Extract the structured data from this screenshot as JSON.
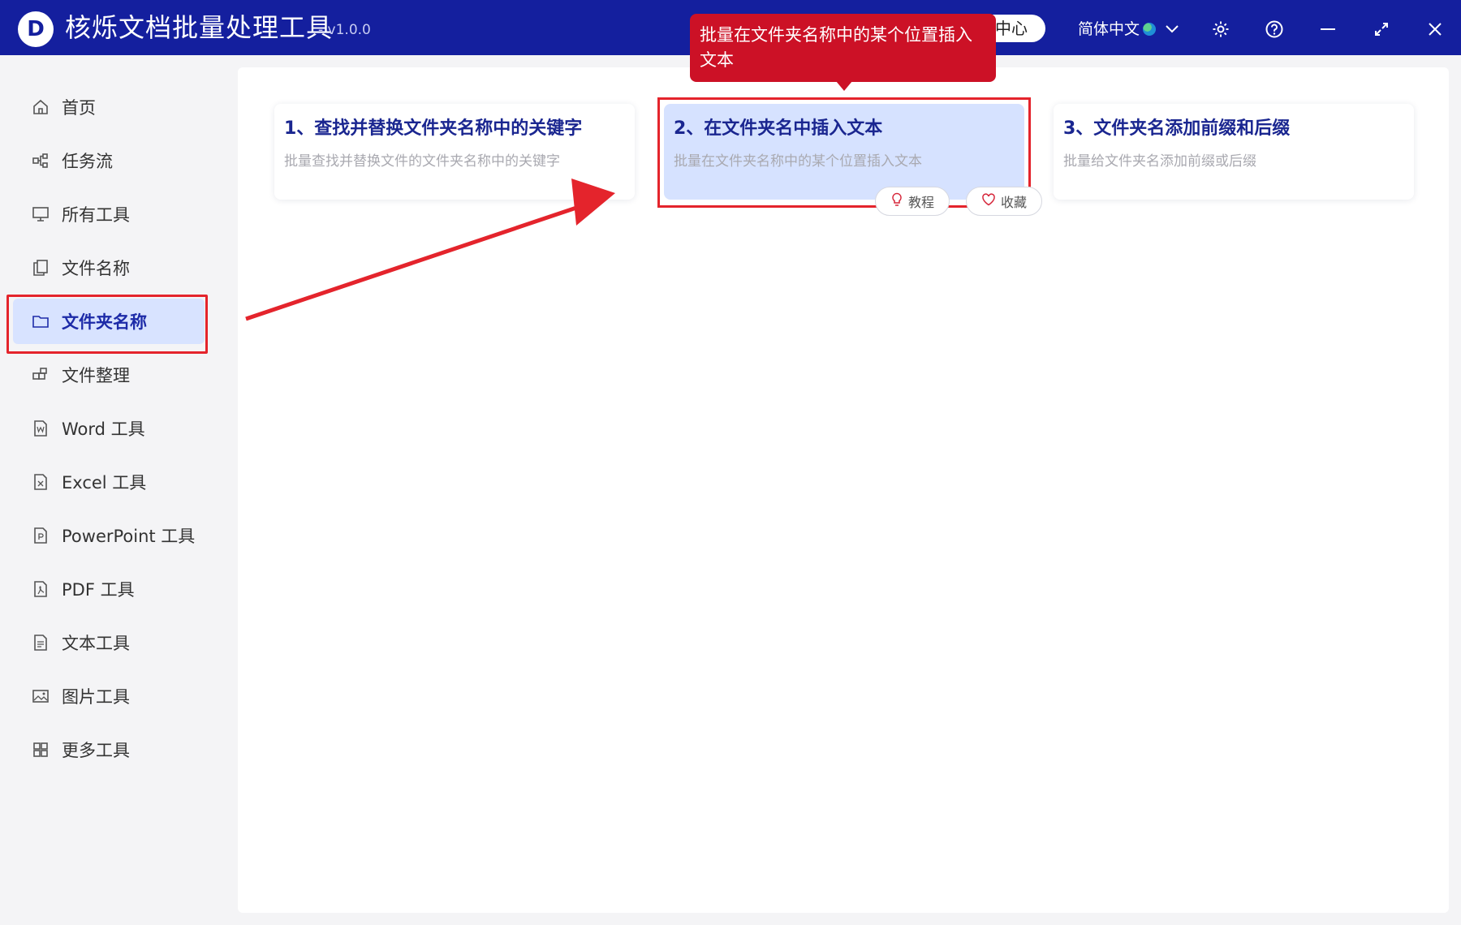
{
  "titlebar": {
    "logo_letter": "D",
    "title": "核烁文档批量处理工具",
    "version": "- v1.0.0",
    "center_label": "中心",
    "language": "简体中文",
    "icons": [
      "globe-icon",
      "chevron-down-icon",
      "gear-icon",
      "help-icon",
      "minimize-icon",
      "maximize-icon",
      "close-icon"
    ]
  },
  "sidebar": {
    "items": [
      {
        "label": "首页",
        "icon": "home-icon"
      },
      {
        "label": "任务流",
        "icon": "workflow-icon"
      },
      {
        "label": "所有工具",
        "icon": "monitor-icon"
      },
      {
        "label": "文件名称",
        "icon": "file-copy-icon"
      },
      {
        "label": "文件夹名称",
        "icon": "folder-icon",
        "active": true
      },
      {
        "label": "文件整理",
        "icon": "organize-icon"
      },
      {
        "label": "Word 工具",
        "icon": "word-file-icon"
      },
      {
        "label": "Excel 工具",
        "icon": "excel-file-icon"
      },
      {
        "label": "PowerPoint 工具",
        "icon": "ppt-file-icon"
      },
      {
        "label": "PDF 工具",
        "icon": "pdf-file-icon"
      },
      {
        "label": "文本工具",
        "icon": "text-file-icon"
      },
      {
        "label": "图片工具",
        "icon": "image-icon"
      },
      {
        "label": "更多工具",
        "icon": "grid-icon"
      }
    ]
  },
  "cards": [
    {
      "title": "1、查找并替换文件夹名称中的关键字",
      "desc": "批量查找并替换文件的文件夹名称中的关键字"
    },
    {
      "title": "2、在文件夹名中插入文本",
      "desc": "批量在文件夹名称中的某个位置插入文本",
      "active": true
    },
    {
      "title": "3、文件夹名添加前缀和后缀",
      "desc": "批量给文件夹名添加前缀或后缀"
    }
  ],
  "card_actions": {
    "tutorial": "教程",
    "favorite": "收藏"
  },
  "tooltip": {
    "text": "批量在文件夹名称中的某个位置插入文本"
  },
  "colors": {
    "titlebar": "#141f9e",
    "accent_text": "#1a2690",
    "active_bg": "#d6e2ff",
    "highlight": "#e4242c",
    "tooltip_bg": "#cc1126"
  }
}
